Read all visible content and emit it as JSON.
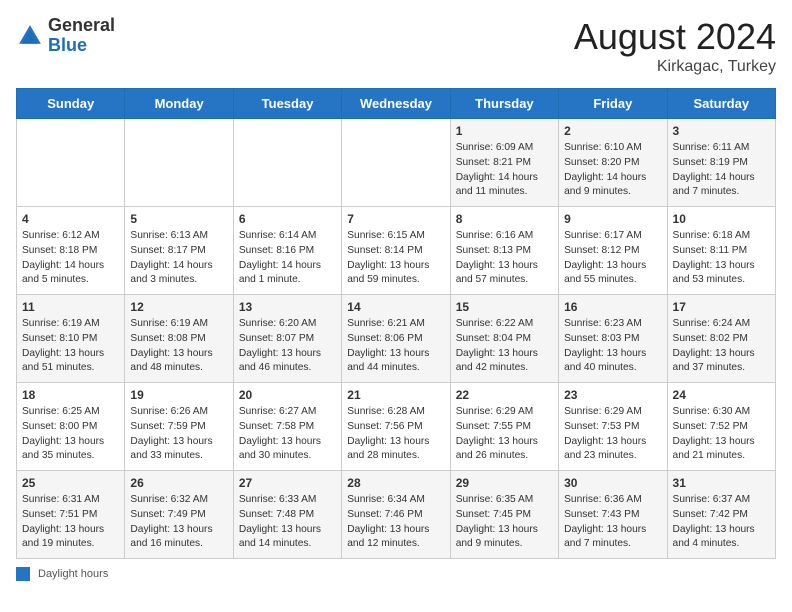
{
  "header": {
    "logo_general": "General",
    "logo_blue": "Blue",
    "month_year": "August 2024",
    "location": "Kirkagac, Turkey"
  },
  "legend": {
    "label": "Daylight hours"
  },
  "days_of_week": [
    "Sunday",
    "Monday",
    "Tuesday",
    "Wednesday",
    "Thursday",
    "Friday",
    "Saturday"
  ],
  "weeks": [
    [
      {
        "day": "",
        "content": ""
      },
      {
        "day": "",
        "content": ""
      },
      {
        "day": "",
        "content": ""
      },
      {
        "day": "",
        "content": ""
      },
      {
        "day": "1",
        "content": "Sunrise: 6:09 AM\nSunset: 8:21 PM\nDaylight: 14 hours and 11 minutes."
      },
      {
        "day": "2",
        "content": "Sunrise: 6:10 AM\nSunset: 8:20 PM\nDaylight: 14 hours and 9 minutes."
      },
      {
        "day": "3",
        "content": "Sunrise: 6:11 AM\nSunset: 8:19 PM\nDaylight: 14 hours and 7 minutes."
      }
    ],
    [
      {
        "day": "4",
        "content": "Sunrise: 6:12 AM\nSunset: 8:18 PM\nDaylight: 14 hours and 5 minutes."
      },
      {
        "day": "5",
        "content": "Sunrise: 6:13 AM\nSunset: 8:17 PM\nDaylight: 14 hours and 3 minutes."
      },
      {
        "day": "6",
        "content": "Sunrise: 6:14 AM\nSunset: 8:16 PM\nDaylight: 14 hours and 1 minute."
      },
      {
        "day": "7",
        "content": "Sunrise: 6:15 AM\nSunset: 8:14 PM\nDaylight: 13 hours and 59 minutes."
      },
      {
        "day": "8",
        "content": "Sunrise: 6:16 AM\nSunset: 8:13 PM\nDaylight: 13 hours and 57 minutes."
      },
      {
        "day": "9",
        "content": "Sunrise: 6:17 AM\nSunset: 8:12 PM\nDaylight: 13 hours and 55 minutes."
      },
      {
        "day": "10",
        "content": "Sunrise: 6:18 AM\nSunset: 8:11 PM\nDaylight: 13 hours and 53 minutes."
      }
    ],
    [
      {
        "day": "11",
        "content": "Sunrise: 6:19 AM\nSunset: 8:10 PM\nDaylight: 13 hours and 51 minutes."
      },
      {
        "day": "12",
        "content": "Sunrise: 6:19 AM\nSunset: 8:08 PM\nDaylight: 13 hours and 48 minutes."
      },
      {
        "day": "13",
        "content": "Sunrise: 6:20 AM\nSunset: 8:07 PM\nDaylight: 13 hours and 46 minutes."
      },
      {
        "day": "14",
        "content": "Sunrise: 6:21 AM\nSunset: 8:06 PM\nDaylight: 13 hours and 44 minutes."
      },
      {
        "day": "15",
        "content": "Sunrise: 6:22 AM\nSunset: 8:04 PM\nDaylight: 13 hours and 42 minutes."
      },
      {
        "day": "16",
        "content": "Sunrise: 6:23 AM\nSunset: 8:03 PM\nDaylight: 13 hours and 40 minutes."
      },
      {
        "day": "17",
        "content": "Sunrise: 6:24 AM\nSunset: 8:02 PM\nDaylight: 13 hours and 37 minutes."
      }
    ],
    [
      {
        "day": "18",
        "content": "Sunrise: 6:25 AM\nSunset: 8:00 PM\nDaylight: 13 hours and 35 minutes."
      },
      {
        "day": "19",
        "content": "Sunrise: 6:26 AM\nSunset: 7:59 PM\nDaylight: 13 hours and 33 minutes."
      },
      {
        "day": "20",
        "content": "Sunrise: 6:27 AM\nSunset: 7:58 PM\nDaylight: 13 hours and 30 minutes."
      },
      {
        "day": "21",
        "content": "Sunrise: 6:28 AM\nSunset: 7:56 PM\nDaylight: 13 hours and 28 minutes."
      },
      {
        "day": "22",
        "content": "Sunrise: 6:29 AM\nSunset: 7:55 PM\nDaylight: 13 hours and 26 minutes."
      },
      {
        "day": "23",
        "content": "Sunrise: 6:29 AM\nSunset: 7:53 PM\nDaylight: 13 hours and 23 minutes."
      },
      {
        "day": "24",
        "content": "Sunrise: 6:30 AM\nSunset: 7:52 PM\nDaylight: 13 hours and 21 minutes."
      }
    ],
    [
      {
        "day": "25",
        "content": "Sunrise: 6:31 AM\nSunset: 7:51 PM\nDaylight: 13 hours and 19 minutes."
      },
      {
        "day": "26",
        "content": "Sunrise: 6:32 AM\nSunset: 7:49 PM\nDaylight: 13 hours and 16 minutes."
      },
      {
        "day": "27",
        "content": "Sunrise: 6:33 AM\nSunset: 7:48 PM\nDaylight: 13 hours and 14 minutes."
      },
      {
        "day": "28",
        "content": "Sunrise: 6:34 AM\nSunset: 7:46 PM\nDaylight: 13 hours and 12 minutes."
      },
      {
        "day": "29",
        "content": "Sunrise: 6:35 AM\nSunset: 7:45 PM\nDaylight: 13 hours and 9 minutes."
      },
      {
        "day": "30",
        "content": "Sunrise: 6:36 AM\nSunset: 7:43 PM\nDaylight: 13 hours and 7 minutes."
      },
      {
        "day": "31",
        "content": "Sunrise: 6:37 AM\nSunset: 7:42 PM\nDaylight: 13 hours and 4 minutes."
      }
    ]
  ]
}
